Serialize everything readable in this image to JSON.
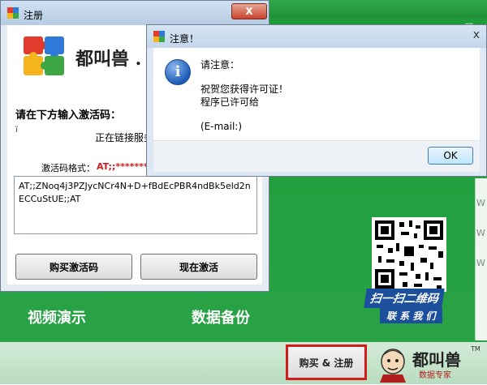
{
  "register_window": {
    "title": "注册",
    "close_label": "X",
    "brand": "都叫兽 .",
    "instruction": "请在下方输入激活码：",
    "small_mark": "ï",
    "status": "正在链接服务",
    "format_label": "激活码格式：",
    "format_value": "AT;;**********",
    "activation_code": "AT;;ZNoq4j3PZJycNCr4N+D+fBdEcPBR4ndBk5eld2nECCuStUE;;AT",
    "buy_button": "购买激活码",
    "activate_button": "现在激活"
  },
  "notice_dialog": {
    "title": "注意！",
    "close_label": "x",
    "heading": "请注意：",
    "line1": "祝贺您获得许可证！",
    "line2": "程序已许可给",
    "email": "(E-mail:)",
    "ok_label": "OK"
  },
  "background_app": {
    "window_buttons": "—  ▢",
    "feature_left": "视频演示",
    "feature_right": "数据备份",
    "qr_banner_top": "扫一扫二维码",
    "qr_banner_bottom": "联 系 我 们",
    "buy_register_label": "购买 & 注册",
    "brand": "都叫兽",
    "brand_tagline": "数据专家",
    "trademark": "TM",
    "right_edge_chars": [
      "W",
      "W",
      "W"
    ]
  },
  "colors": {
    "app_green": "#23a03f",
    "highlight_red": "#d21c1c",
    "qr_blue": "#1c4f9c"
  }
}
